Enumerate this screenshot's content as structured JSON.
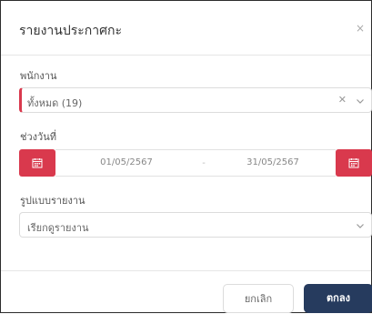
{
  "dialog": {
    "title": "รายงานประกาศกะ",
    "close_symbol": "×"
  },
  "employee": {
    "label": "พนักงาน",
    "value": "ทั้งหมด (19)",
    "clear_symbol": "✕"
  },
  "date_range": {
    "label": "ช่วงวันที่",
    "start": "01/05/2567",
    "separator": "-",
    "end": "31/05/2567"
  },
  "report_format": {
    "label": "รูปแบบรายงาน",
    "value": "เรียกดูรายงาน"
  },
  "footer": {
    "cancel_label": "ยกเลิก",
    "ok_label": "ตกลง"
  },
  "colors": {
    "accent_red": "#d9394d",
    "primary_navy": "#263b5e"
  }
}
